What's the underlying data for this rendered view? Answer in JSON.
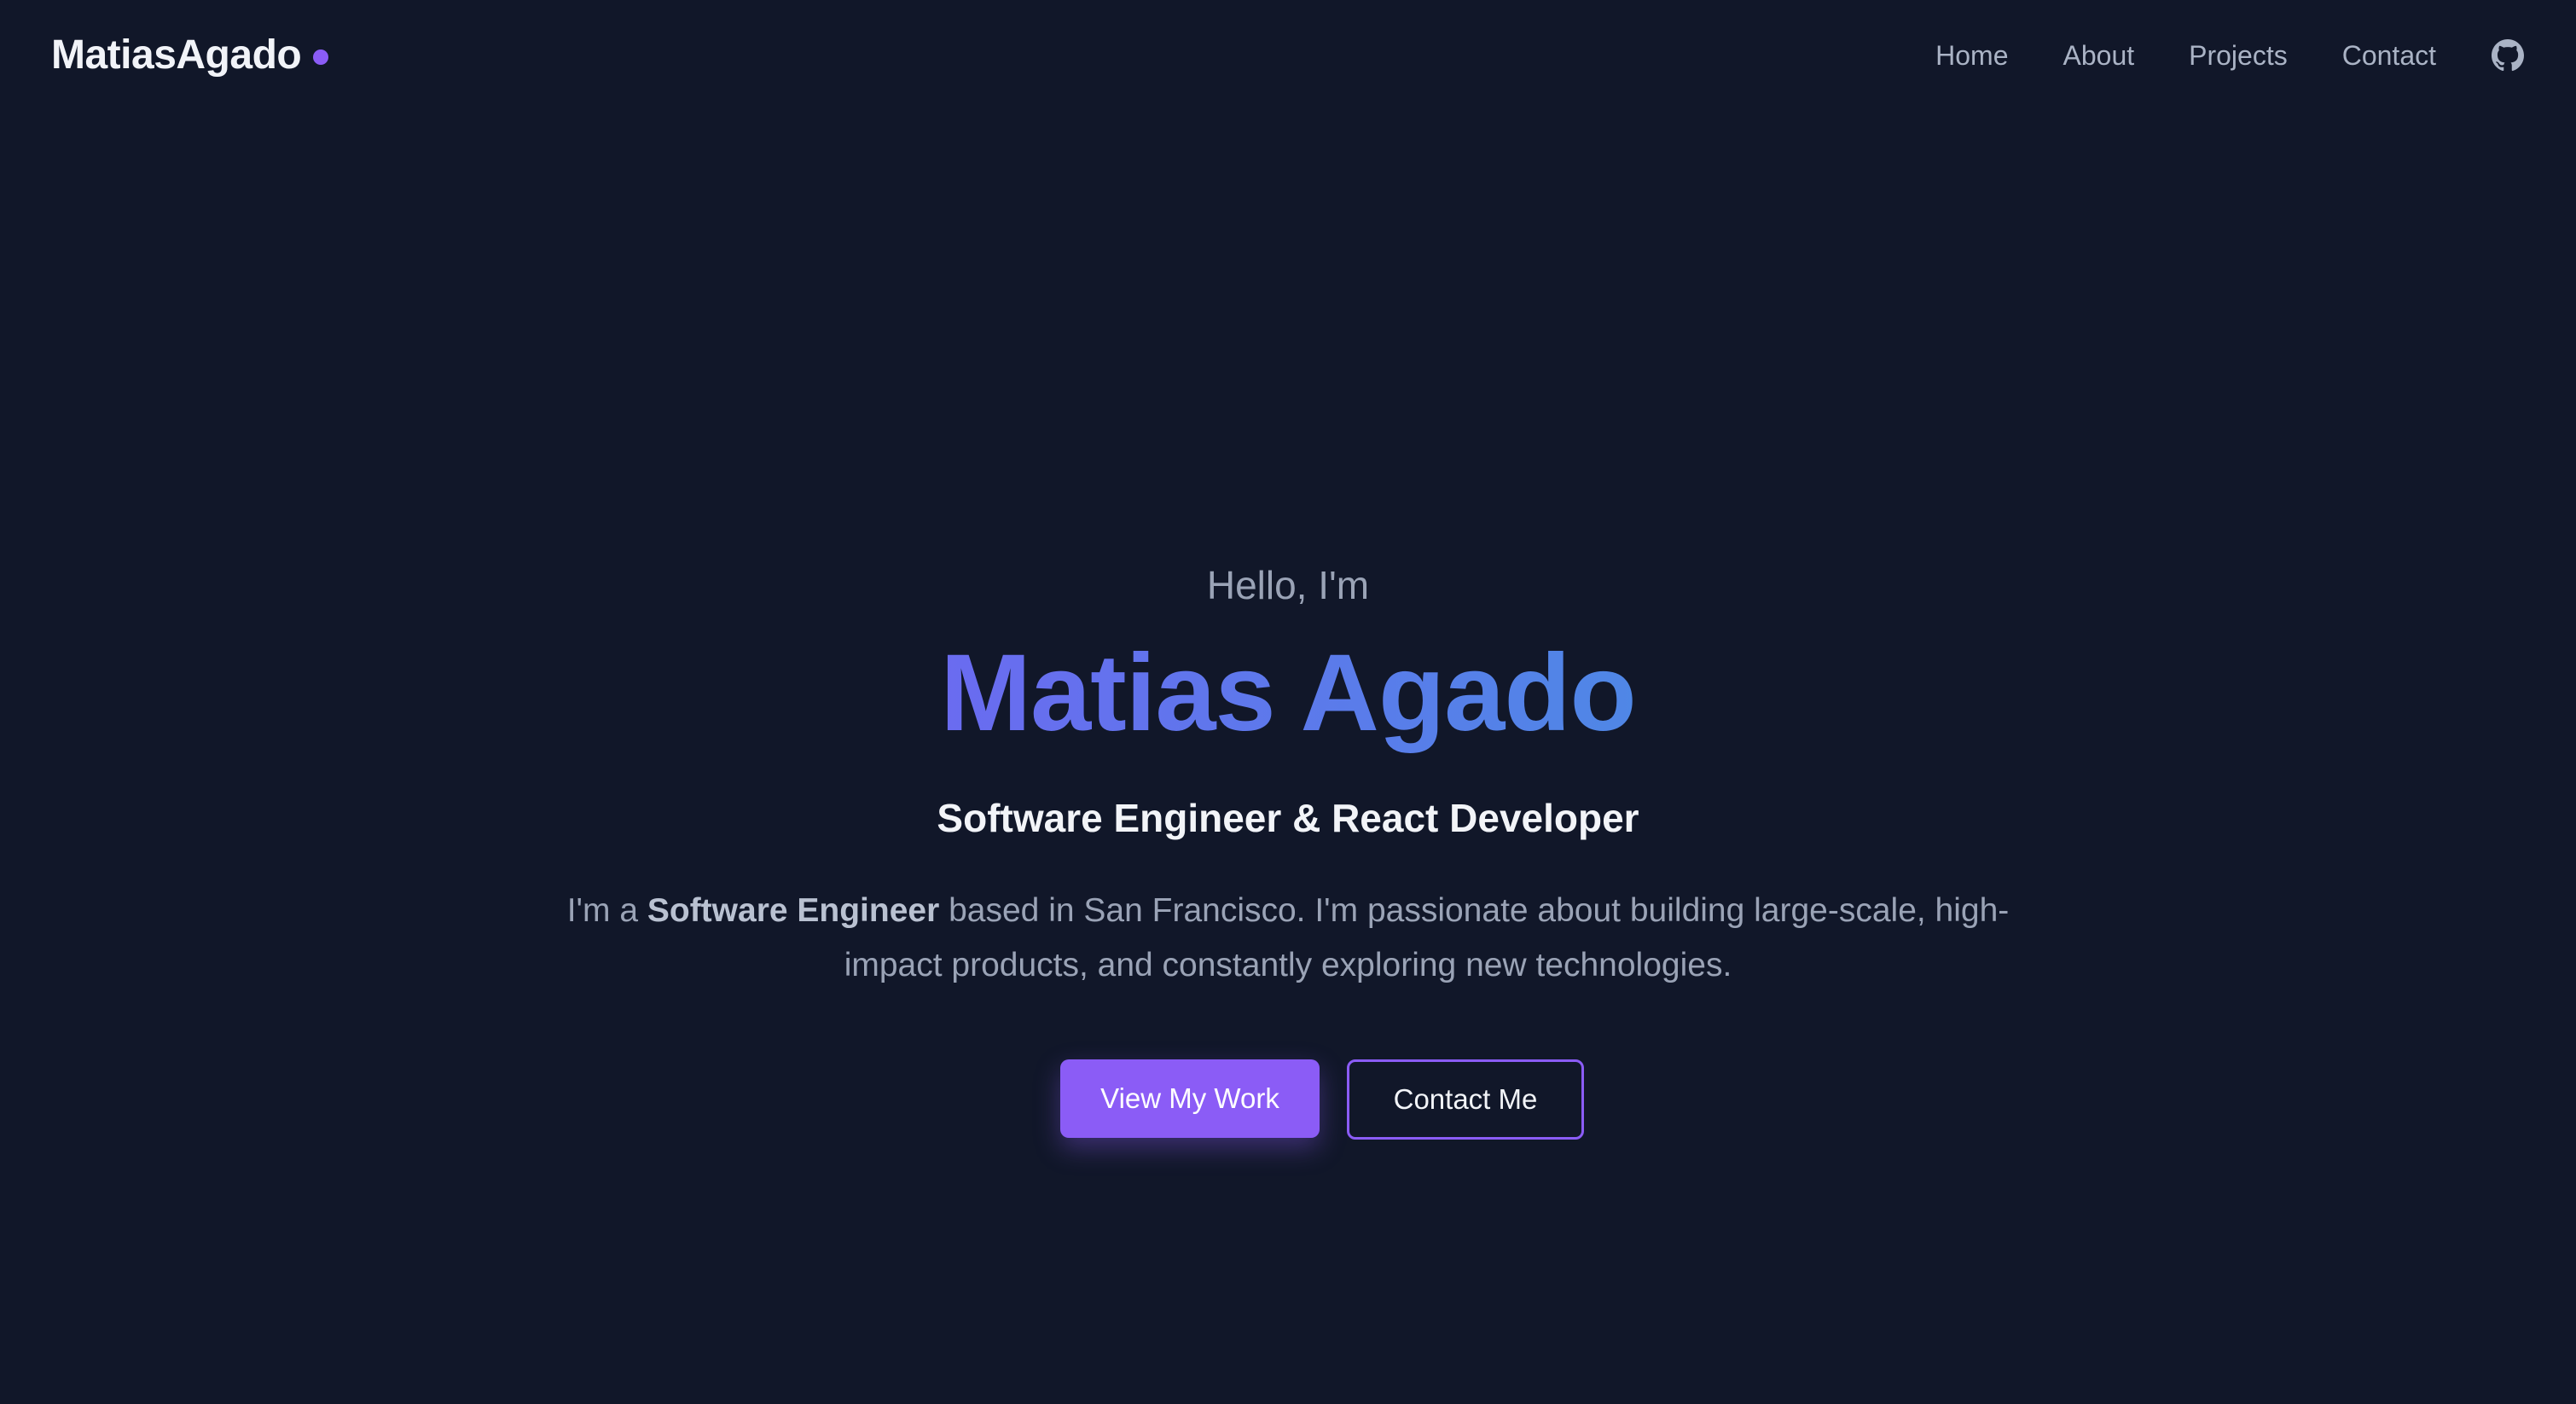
{
  "header": {
    "brand": "MatiasAgado",
    "brand_dot_color": "#8b5cf6",
    "nav": [
      {
        "label": "Home"
      },
      {
        "label": "About"
      },
      {
        "label": "Projects"
      },
      {
        "label": "Contact"
      }
    ],
    "github_icon": "github-icon"
  },
  "hero": {
    "greeting": "Hello, I'm",
    "name": "Matias Agado",
    "title": "Software Engineer & React Developer",
    "bio": {
      "prefix": "I'm a ",
      "emphasis": "Software Engineer",
      "suffix": " based in San Francisco. I'm passionate about building large-scale, high-impact products, and constantly exploring new technologies."
    },
    "primary_button": "View My Work",
    "secondary_button": "Contact Me",
    "accent_color": "#8b5cf6",
    "name_gradient": [
      "#6a6bf0",
      "#4f87e6"
    ]
  },
  "colors": {
    "background": "#111729",
    "text_muted": "#9aa3b6",
    "text_light": "#f2f4f8"
  }
}
